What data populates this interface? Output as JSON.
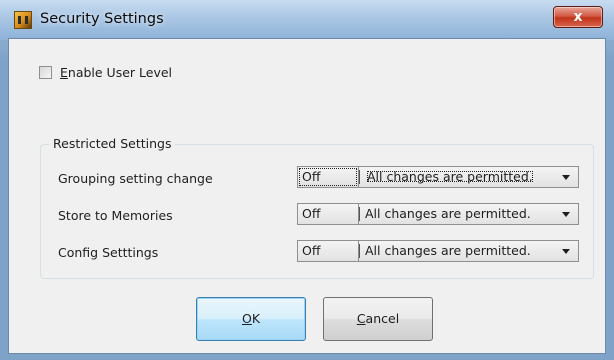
{
  "window": {
    "title": "Security Settings",
    "close_glyph": "x"
  },
  "enable_user_level": {
    "label": "Enable User Level",
    "mnemonic": "E",
    "rest": "nable User Level",
    "checked": false
  },
  "restricted": {
    "group_title": "Restricted Settings",
    "rows": [
      {
        "label": "Grouping setting change",
        "level": "Off",
        "permission": "All changes are permitted."
      },
      {
        "label": "Store to Memories",
        "level": "Off",
        "permission": "All changes are permitted."
      },
      {
        "label": "Config Setttings",
        "level": "Off",
        "permission": "All changes are permitted."
      }
    ]
  },
  "buttons": {
    "ok": {
      "mnemonic": "O",
      "rest": "K"
    },
    "cancel": {
      "mnemonic": "C",
      "rest": "ancel"
    }
  },
  "colors": {
    "title_gradient_top": "#c8dcf0",
    "close_button": "#c2331b",
    "dialog_background": "#f0f0f0",
    "default_button_border": "#3c7fb1"
  }
}
